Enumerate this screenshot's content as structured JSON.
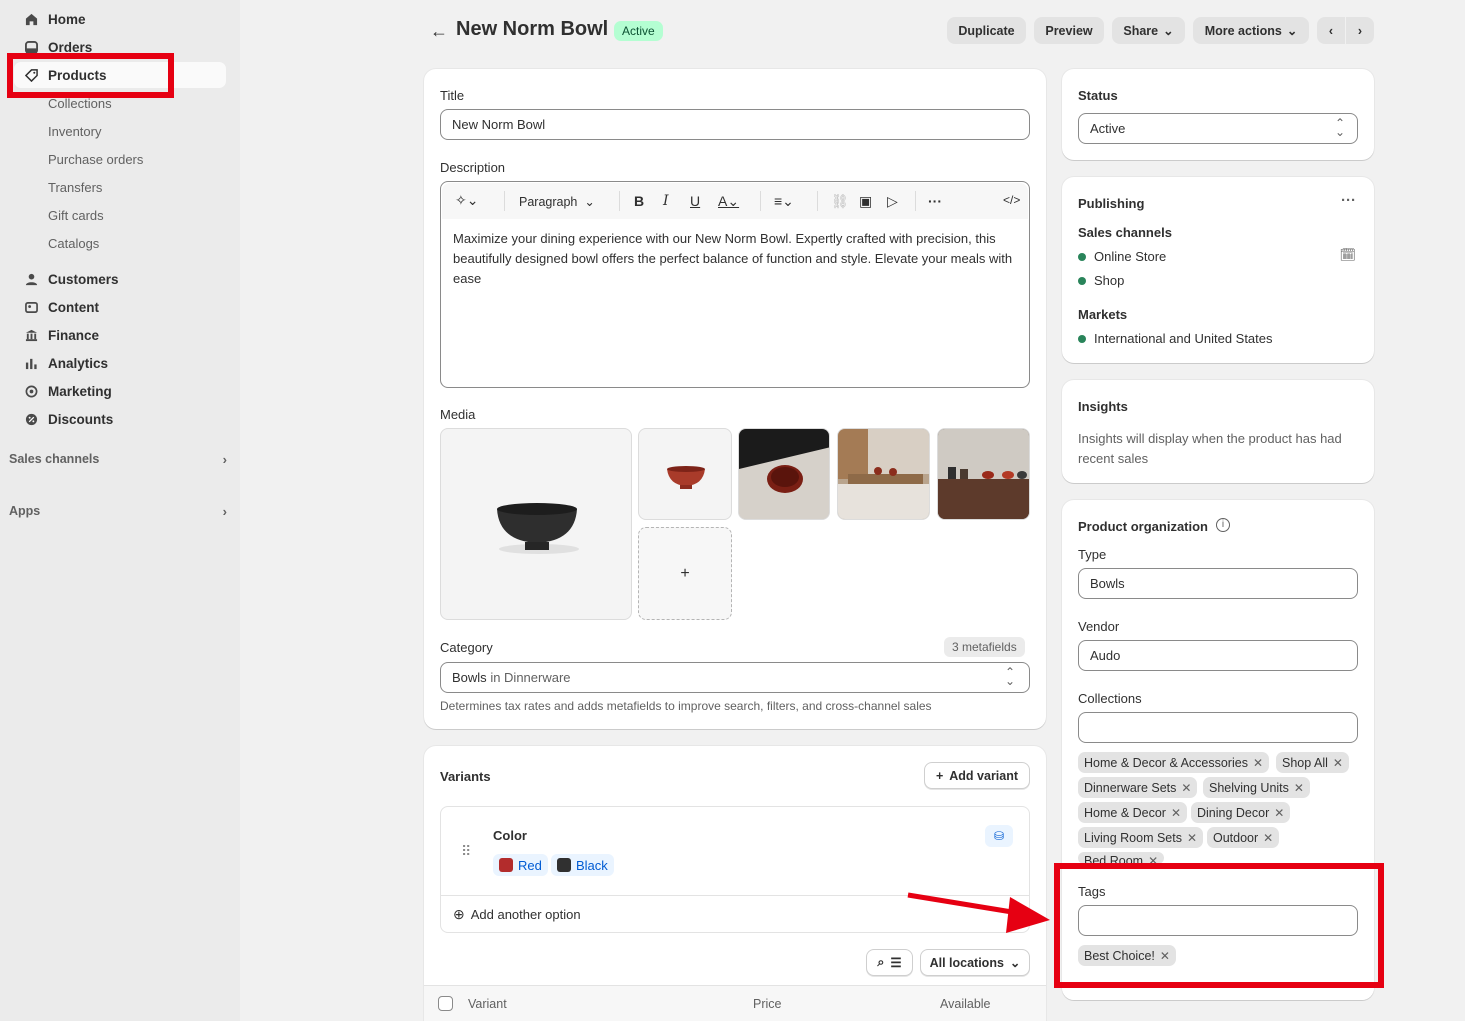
{
  "sidebar": {
    "items": [
      {
        "label": "Home",
        "icon": "home-icon"
      },
      {
        "label": "Orders",
        "icon": "orders-icon"
      },
      {
        "label": "Products",
        "icon": "tag-icon"
      },
      {
        "label": "Customers",
        "icon": "person-icon"
      },
      {
        "label": "Content",
        "icon": "content-icon"
      },
      {
        "label": "Finance",
        "icon": "bank-icon"
      },
      {
        "label": "Analytics",
        "icon": "bar-chart-icon"
      },
      {
        "label": "Marketing",
        "icon": "target-icon"
      },
      {
        "label": "Discounts",
        "icon": "discount-icon"
      }
    ],
    "product_subitems": [
      "Collections",
      "Inventory",
      "Purchase orders",
      "Transfers",
      "Gift cards",
      "Catalogs"
    ],
    "sales_channels_label": "Sales channels",
    "apps_label": "Apps"
  },
  "header": {
    "title": "New Norm Bowl",
    "status_badge": "Active",
    "duplicate": "Duplicate",
    "preview": "Preview",
    "share": "Share",
    "more_actions": "More actions"
  },
  "product": {
    "title_label": "Title",
    "title_value": "New Norm Bowl",
    "description_label": "Description",
    "paragraph_format": "Paragraph",
    "description_text": "Maximize your dining experience with our New Norm Bowl. Expertly crafted with precision, this beautifully designed bowl offers the perfect balance of function and style. Elevate your meals with ease",
    "media_label": "Media",
    "category_label": "Category",
    "metafields_badge": "3 metafields",
    "category_value": "Bowls",
    "category_in": "in Dinnerware",
    "category_help": "Determines tax rates and adds metafields to improve search, filters, and cross-channel sales",
    "add_media_symbol": "+"
  },
  "variants": {
    "heading": "Variants",
    "add_variant": "Add variant",
    "option_name": "Color",
    "values": [
      {
        "label": "Red",
        "color": "#b32c2c"
      },
      {
        "label": "Black",
        "color": "#303030"
      }
    ],
    "add_option": "Add another option",
    "locations": "All locations",
    "col_variant": "Variant",
    "col_price": "Price",
    "col_available": "Available"
  },
  "status": {
    "label": "Status",
    "value": "Active"
  },
  "publishing": {
    "heading": "Publishing",
    "sales_channels_label": "Sales channels",
    "channels": [
      "Online Store",
      "Shop"
    ],
    "markets_label": "Markets",
    "markets": [
      "International and United States"
    ]
  },
  "insights": {
    "heading": "Insights",
    "text": "Insights will display when the product has had recent sales"
  },
  "organization": {
    "heading": "Product organization",
    "type_label": "Type",
    "type_value": "Bowls",
    "vendor_label": "Vendor",
    "vendor_value": "Audo",
    "collections_label": "Collections",
    "collections": [
      "Home & Decor & Accessories",
      "Shop All",
      "Dinnerware Sets",
      "Shelving Units",
      "Home & Decor",
      "Dining Decor",
      "Living Room Sets",
      "Outdoor",
      "Bed Room"
    ],
    "tags_label": "Tags",
    "tags": [
      "Best Choice!"
    ]
  },
  "colors": {
    "annotation": "#e60012",
    "active_badge_bg": "#b4fed2",
    "channel_dot": "#29845a"
  }
}
